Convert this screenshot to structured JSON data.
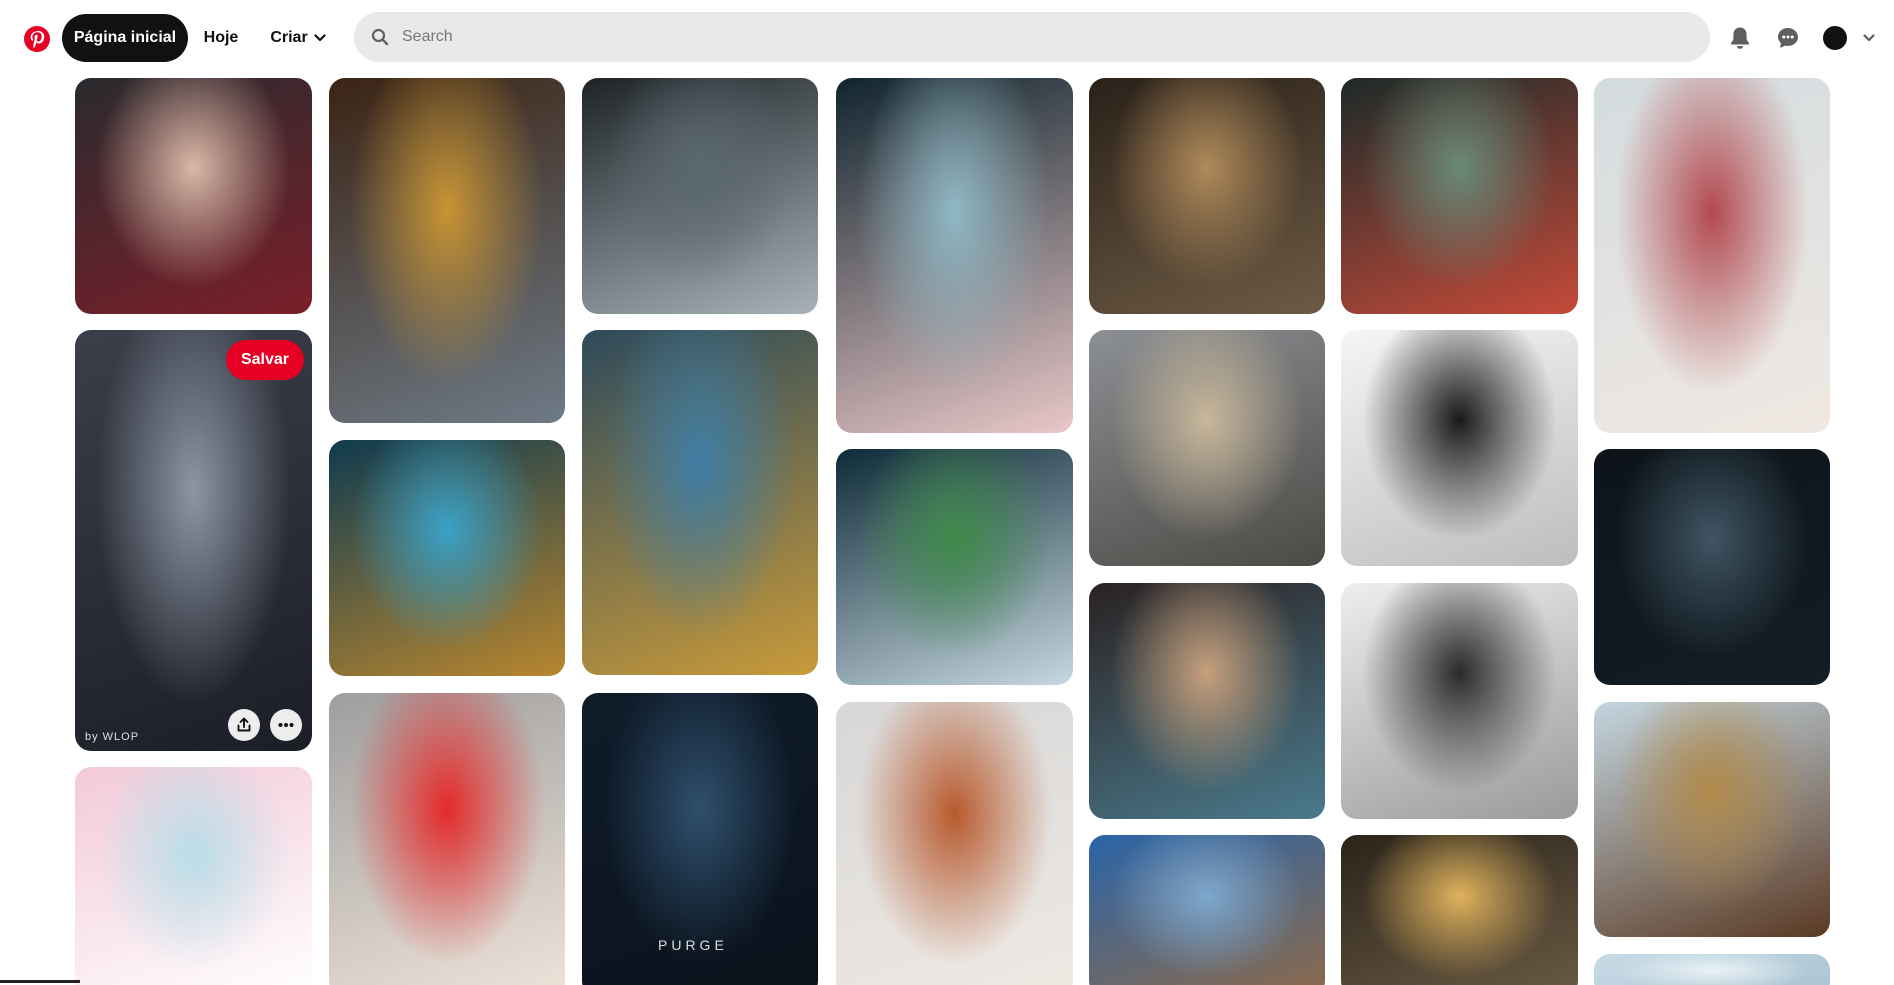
{
  "header": {
    "logo_icon": "pinterest-logo",
    "nav": {
      "home_label": "Página inicial",
      "today_label": "Hoje",
      "create_label": "Criar"
    },
    "search": {
      "placeholder": "Search",
      "value": ""
    },
    "icons": [
      "bell-icon",
      "chat-icon",
      "avatar",
      "chevron-down-icon"
    ]
  },
  "colors": {
    "brand_red": "#e60023",
    "active_pill": "#111111",
    "search_bg": "#e9e9e9"
  },
  "feed": {
    "hovered_pin": {
      "save_label": "Salvar",
      "actions": [
        "share-icon",
        "more-icon"
      ]
    },
    "pins": [
      {
        "subject": "fantasy woman portrait with jeweled veil",
        "colors": [
          "#2a2a2e",
          "#d9b8a7",
          "#7a1f2a"
        ]
      },
      {
        "subject": "dancers in dark star dress",
        "colors": [
          "#3a3f4a",
          "#8d96a3",
          "#1b1e26"
        ],
        "caption": "by WLOP"
      },
      {
        "subject": "retro pinup woman by pink fridge",
        "colors": [
          "#f3c9d8",
          "#b8dde8",
          "#ffffff"
        ]
      },
      {
        "subject": "golden armored queen",
        "colors": [
          "#3b2414",
          "#c89434",
          "#6d7a86"
        ]
      },
      {
        "subject": "masked woman with blue ornaments",
        "colors": [
          "#0f3b4f",
          "#3aa1c7",
          "#b8862f"
        ]
      },
      {
        "subject": "black and white actress with red coat",
        "colors": [
          "#9e9e9e",
          "#e42a2a",
          "#efe3d9"
        ]
      },
      {
        "subject": "dark industrial interior",
        "colors": [
          "#1d2327",
          "#5b6870",
          "#a7b3b8"
        ]
      },
      {
        "subject": "blue helmet warrior woman",
        "colors": [
          "#2d4a5b",
          "#3f7ea5",
          "#c89a3a"
        ]
      },
      {
        "subject": "sci-fi poster",
        "colors": [
          "#0f1c2a",
          "#2f4f6d",
          "#0a121b"
        ],
        "caption": "PURGE"
      },
      {
        "subject": "ethereal flower gown figure",
        "colors": [
          "#10242e",
          "#8fb8c4",
          "#e9c8c8"
        ]
      },
      {
        "subject": "tree head surreal landscape",
        "colors": [
          "#0e2a38",
          "#3f8a4a",
          "#c6d8e0"
        ]
      },
      {
        "subject": "red haired adventurer",
        "colors": [
          "#d7d7d7",
          "#b85a2e",
          "#efe9e3"
        ]
      },
      {
        "subject": "golden astronomical machine",
        "colors": [
          "#2a2119",
          "#b08a5a",
          "#6d5a44"
        ]
      },
      {
        "subject": "ancient temple with statue",
        "colors": [
          "#8c8f94",
          "#c8b79a",
          "#4c4a45"
        ]
      },
      {
        "subject": "armored elf warrior",
        "colors": [
          "#2a2223",
          "#c7a07c",
          "#4a7a8c"
        ]
      },
      {
        "subject": "whale sky fantasy",
        "colors": [
          "#2a64a8",
          "#7ea7cc",
          "#8d6a4a"
        ]
      },
      {
        "subject": "crowd protest collage",
        "colors": [
          "#1d2a28",
          "#6a8a78",
          "#c54a3a"
        ]
      },
      {
        "subject": "black and white actress portrait",
        "colors": [
          "#f5f5f5",
          "#1a1a1a",
          "#bdbdbd"
        ]
      },
      {
        "subject": "black and white actress sophia",
        "colors": [
          "#eeeeee",
          "#2b2b2b",
          "#9a9a9a"
        ]
      },
      {
        "subject": "figure in golden clouds",
        "colors": [
          "#2a241a",
          "#e0b25c",
          "#6a5a44"
        ]
      },
      {
        "subject": "actress in white dress",
        "colors": [
          "#d4dcdf",
          "#b24a50",
          "#f0e8e2"
        ]
      },
      {
        "subject": "dark mechanical pattern",
        "colors": [
          "#0d1419",
          "#3f5563",
          "#141d24"
        ]
      },
      {
        "subject": "ancient warriors with shields",
        "colors": [
          "#c4d6e0",
          "#b0894a",
          "#5a3a24"
        ]
      },
      {
        "subject": "partially visible pin",
        "colors": [
          "#c7dbe6",
          "#eaf2f6",
          "#a9c3d1"
        ]
      }
    ]
  }
}
